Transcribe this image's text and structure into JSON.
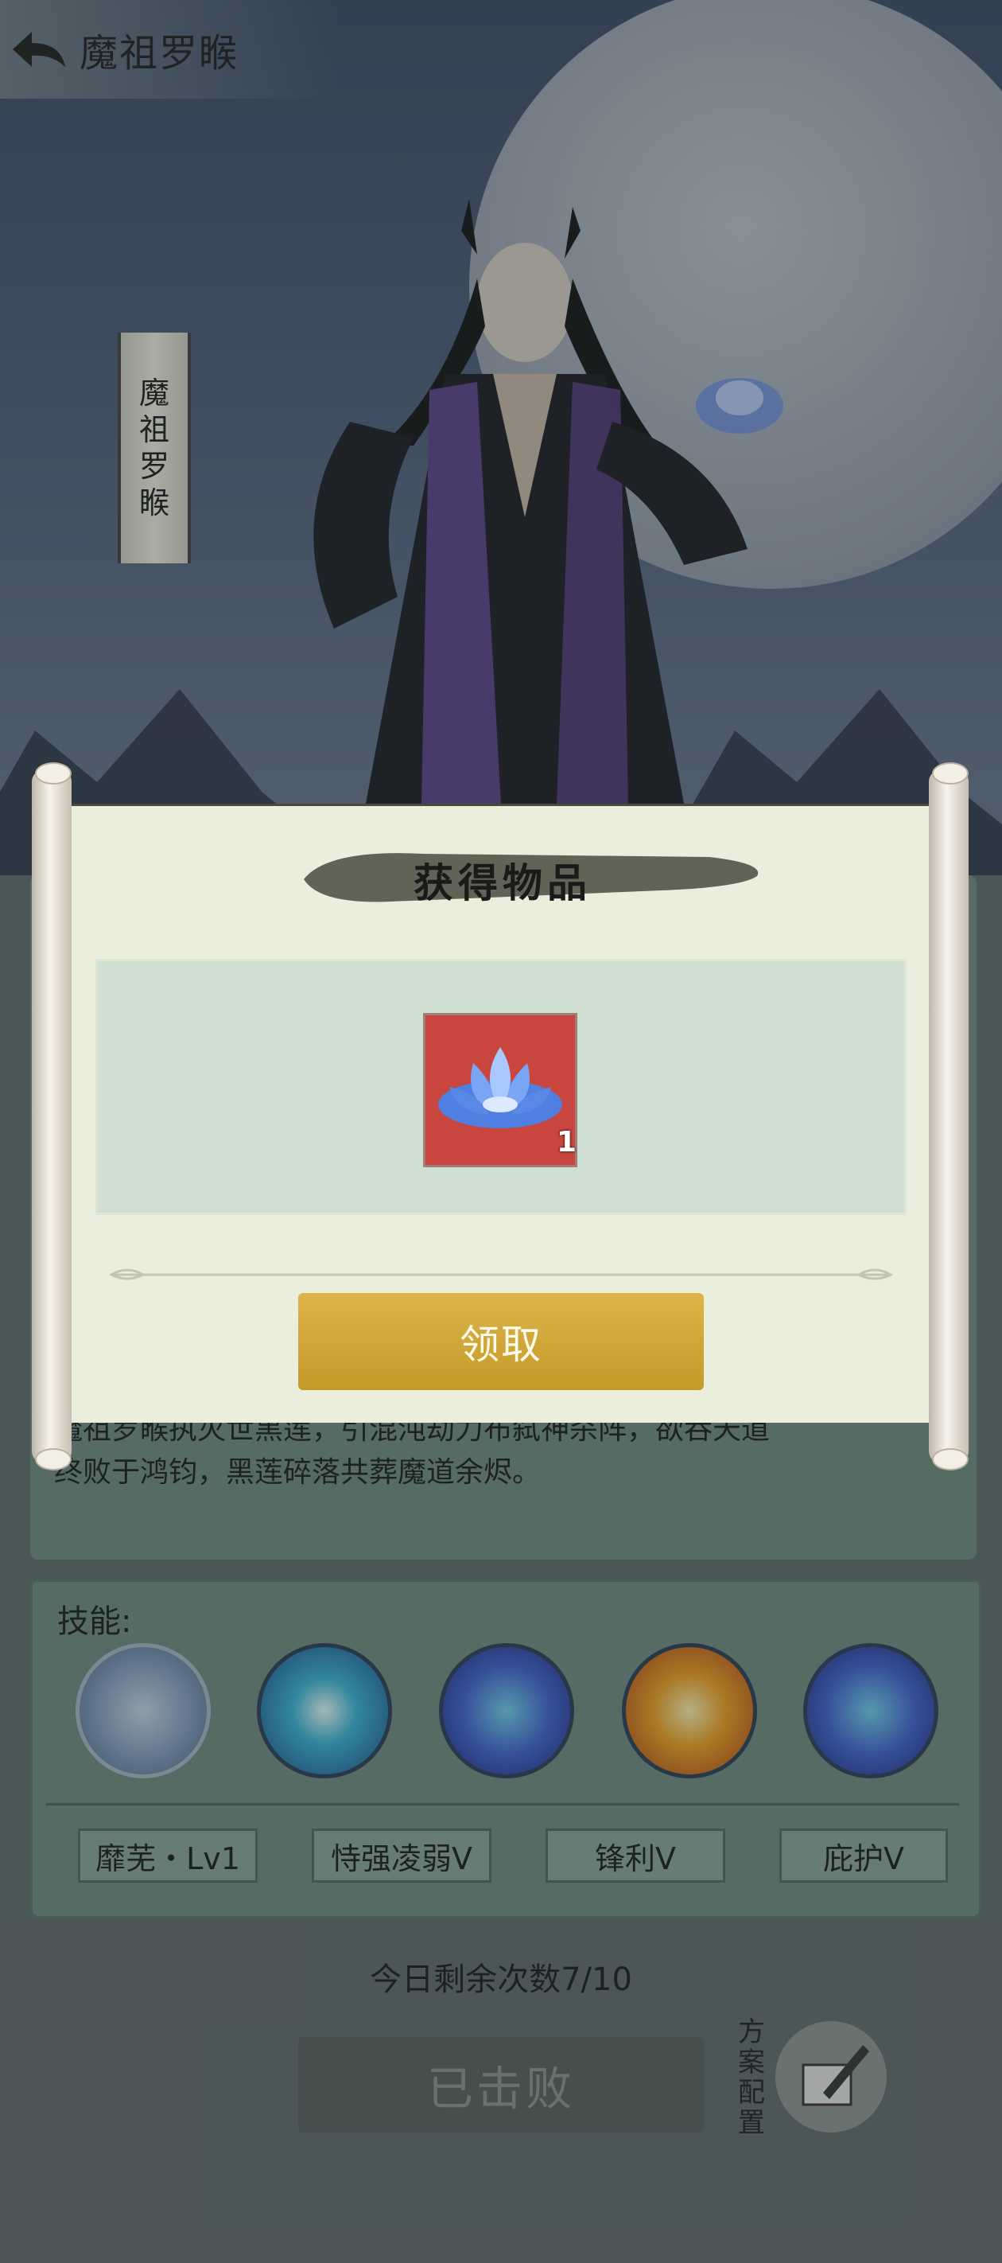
{
  "header": {
    "title": "魔祖罗睺"
  },
  "banner": {
    "name_chars": [
      "魔",
      "祖",
      "罗",
      "睺"
    ]
  },
  "description": {
    "line1": "魔祖罗睺执灭世黑莲，引混沌劫力布弑神杀阵，欲吞天道",
    "line2": "终败于鸿钧，黑莲碎落共葬魔道余烬。"
  },
  "skills": {
    "label": "技能:",
    "icons": [
      "lotus-skill-icon",
      "burst-skill-icon",
      "shield-swirl-skill-icon",
      "explosion-skill-icon",
      "shield-swirl-skill-icon"
    ],
    "tags": [
      "靡芜・Lv1",
      "恃强凌弱V",
      "锋利V",
      "庇护V"
    ]
  },
  "remaining": "今日剩余次数7/10",
  "defeated_button": "已击败",
  "plan_config": {
    "label_chars": [
      "方",
      "案",
      "配",
      "置"
    ]
  },
  "modal": {
    "title": "获得物品",
    "item": {
      "icon": "blue-lotus-icon",
      "count": "1"
    },
    "claim_label": "领取"
  },
  "colors": {
    "claim_button": "#d4aa3c",
    "item_slot": "#c8463e",
    "panel": "#6f8a80"
  }
}
